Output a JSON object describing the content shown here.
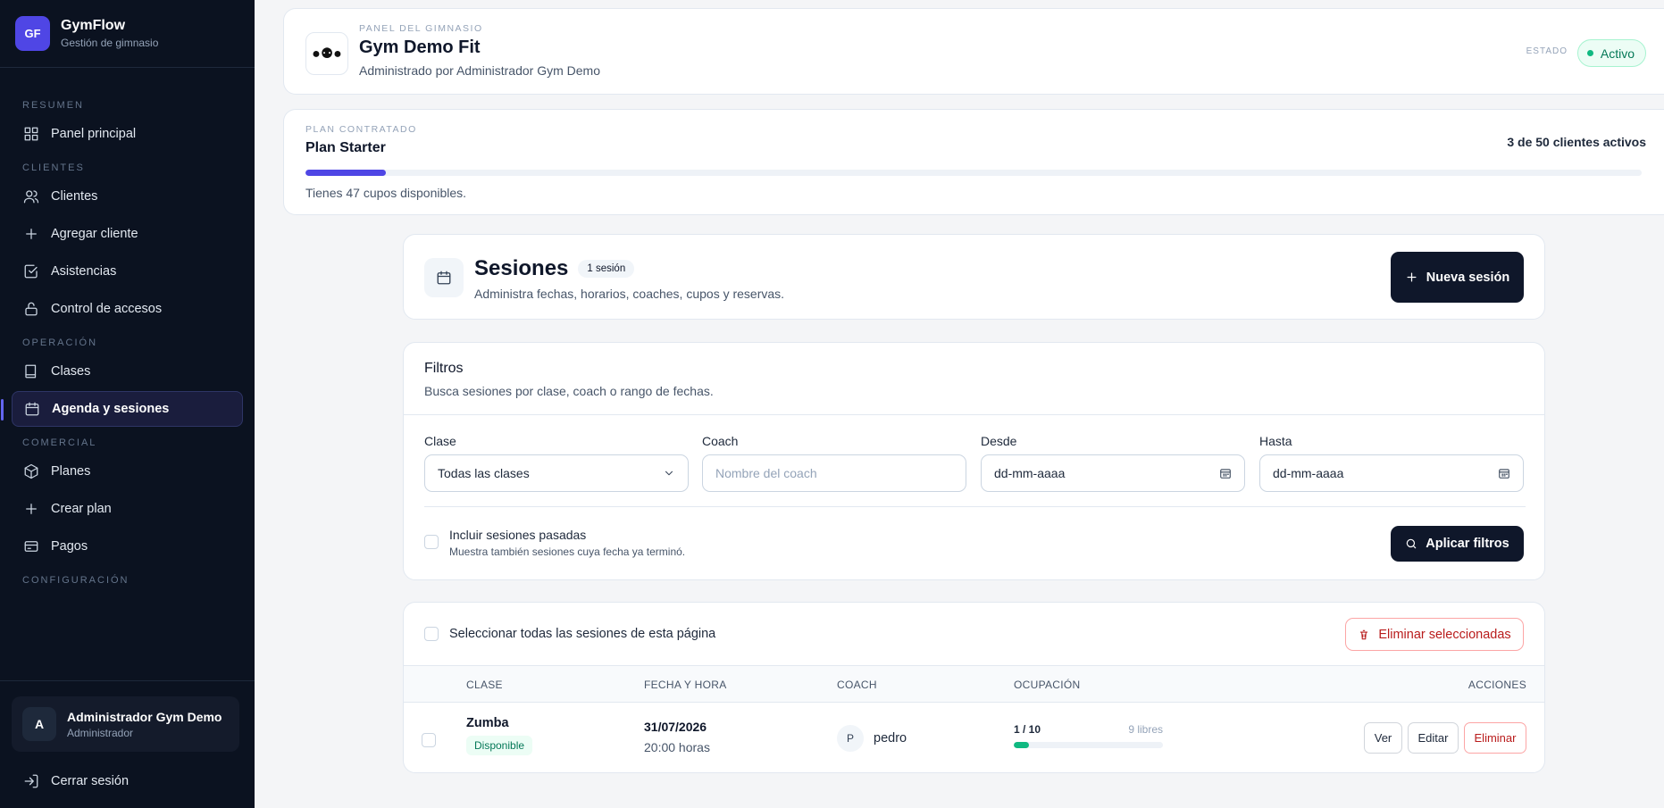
{
  "colors": {
    "sidebar_bg": "#0b1220",
    "accent": "#4f46e5",
    "success": "#10b981",
    "danger": "#b91c1c",
    "dark_button": "#0f172a"
  },
  "brand": {
    "logo": "GF",
    "name": "GymFlow",
    "subtitle": "Gestión de gimnasio"
  },
  "sidebar": {
    "sections": [
      {
        "label": "RESUMEN",
        "items": [
          {
            "label": "Panel principal",
            "icon": "dashboard-icon"
          }
        ]
      },
      {
        "label": "CLIENTES",
        "items": [
          {
            "label": "Clientes",
            "icon": "users-icon"
          },
          {
            "label": "Agregar cliente",
            "icon": "plus-icon"
          },
          {
            "label": "Asistencias",
            "icon": "check-square-icon"
          },
          {
            "label": "Control de accesos",
            "icon": "lock-icon"
          }
        ]
      },
      {
        "label": "OPERACIÓN",
        "items": [
          {
            "label": "Clases",
            "icon": "book-icon"
          },
          {
            "label": "Agenda y sesiones",
            "icon": "calendar-icon",
            "active": true
          }
        ]
      },
      {
        "label": "COMERCIAL",
        "items": [
          {
            "label": "Planes",
            "icon": "box-icon"
          },
          {
            "label": "Crear plan",
            "icon": "plus-icon"
          },
          {
            "label": "Pagos",
            "icon": "credit-card-icon"
          }
        ]
      },
      {
        "label": "CONFIGURACIÓN",
        "items": []
      }
    ],
    "user": {
      "initial": "A",
      "name": "Administrador Gym Demo",
      "role": "Administrador"
    },
    "logout_label": "Cerrar sesión"
  },
  "gym": {
    "eyebrow": "PANEL DEL GIMNASIO",
    "name": "Gym Demo Fit",
    "managed_by": "Administrado por Administrador Gym Demo",
    "status_label": "ESTADO",
    "status": "Activo"
  },
  "plan": {
    "eyebrow": "PLAN CONTRATADO",
    "name": "Plan Starter",
    "usage": "3 de 50 clientes activos",
    "usage_fraction": 0.06,
    "note": "Tienes 47 cupos disponibles."
  },
  "sessions": {
    "title": "Sesiones",
    "count": "1 sesión",
    "subtitle": "Administra fechas, horarios, coaches, cupos y reservas.",
    "new_button": "Nueva sesión"
  },
  "filters": {
    "title": "Filtros",
    "subtitle": "Busca sesiones por clase, coach o rango de fechas.",
    "class_label": "Clase",
    "class_value": "Todas las clases",
    "coach_label": "Coach",
    "coach_placeholder": "Nombre del coach",
    "from_label": "Desde",
    "from_value": "dd-mm-aaaa",
    "to_label": "Hasta",
    "to_value": "dd-mm-aaaa",
    "past_title": "Incluir sesiones pasadas",
    "past_sub": "Muestra también sesiones cuya fecha ya terminó.",
    "apply_button": "Aplicar filtros"
  },
  "table": {
    "select_all": "Seleccionar todas las sesiones de esta página",
    "delete_selected": "Eliminar seleccionadas",
    "headers": {
      "class": "CLASE",
      "datetime": "FECHA Y HORA",
      "coach": "COACH",
      "occupancy": "OCUPACIÓN",
      "actions": "ACCIONES"
    },
    "rows": [
      {
        "class": "Zumba",
        "status": "Disponible",
        "date": "31/07/2026",
        "time": "20:00 horas",
        "coach_initial": "P",
        "coach": "pedro",
        "occupancy": "1 / 10",
        "occupancy_fraction": 0.1,
        "free": "9 libres",
        "actions": {
          "view": "Ver",
          "edit": "Editar",
          "delete": "Eliminar"
        }
      }
    ]
  }
}
